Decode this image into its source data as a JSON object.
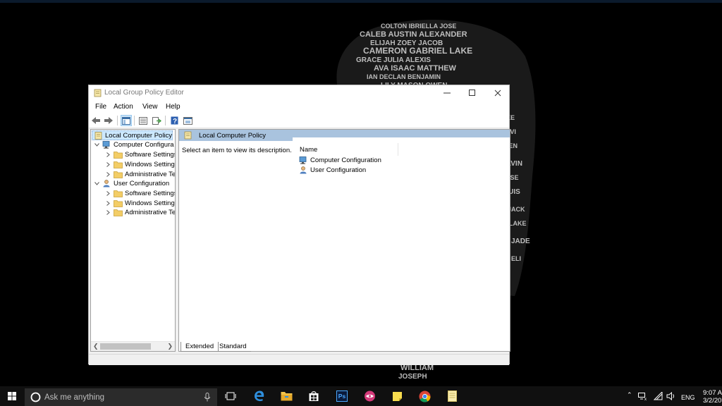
{
  "window": {
    "title": "Local Group Policy Editor",
    "buttons": {
      "minimize": "minimize",
      "maximize": "maximize",
      "close": "close"
    }
  },
  "menu": [
    "File",
    "Action",
    "View",
    "Help"
  ],
  "toolbar": {
    "icons": [
      "back-arrow-icon",
      "forward-arrow-icon",
      "show-hide-console-tree-icon",
      "properties-icon",
      "export-list-icon",
      "help-icon",
      "toggle-view-icon"
    ]
  },
  "tree": {
    "root": "Local Computer Policy",
    "items": [
      {
        "label": "Computer Configura",
        "level": 1,
        "expanded": true
      },
      {
        "label": "Software Settings",
        "level": 2,
        "expanded": false
      },
      {
        "label": "Windows Setting",
        "level": 2,
        "expanded": false
      },
      {
        "label": "Administrative Te",
        "level": 2,
        "expanded": false
      },
      {
        "label": "User Configuration",
        "level": 1,
        "expanded": true
      },
      {
        "label": "Software Settings",
        "level": 2,
        "expanded": false
      },
      {
        "label": "Windows Setting",
        "level": 2,
        "expanded": false
      },
      {
        "label": "Administrative Te",
        "level": 2,
        "expanded": false
      }
    ]
  },
  "details": {
    "header": "Local Computer Policy",
    "description": "Select an item to view its description.",
    "column_name": "Name",
    "rows": [
      "Computer Configuration",
      "User Configuration"
    ],
    "tabs": [
      "Extended",
      "Standard"
    ],
    "active_tab": "Extended"
  },
  "taskbar": {
    "search_placeholder": "Ask me anything",
    "pinned": [
      "task-view-icon",
      "edge-icon",
      "file-explorer-icon",
      "store-icon",
      "photoshop-icon",
      "app-icon",
      "sticky-notes-icon",
      "chrome-icon",
      "notepad-icon"
    ],
    "photoshop_label": "Ps",
    "tray": {
      "language": "ENG"
    },
    "clock": {
      "time": "9:07 A",
      "date": "3/2/20"
    }
  },
  "colors": {
    "header_blue": "#a9c3de",
    "selection": "#cce8ff",
    "taskbar": "#101010",
    "desktop": "#000000"
  }
}
